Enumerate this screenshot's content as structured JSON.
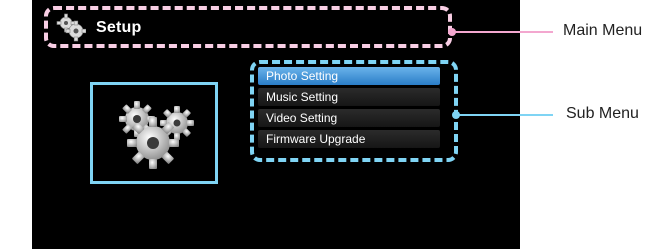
{
  "main_menu": {
    "title": "Setup",
    "icon": "gear-icon"
  },
  "sub_menu": {
    "items": [
      {
        "label": "Photo Setting",
        "active": true
      },
      {
        "label": "Music Setting",
        "active": false
      },
      {
        "label": "Video Setting",
        "active": false
      },
      {
        "label": "Firmware Upgrade",
        "active": false
      }
    ]
  },
  "callouts": {
    "main_menu_label": "Main Menu",
    "sub_menu_label": "Sub Menu"
  },
  "colors": {
    "main_menu_outline": "#f3a7cf",
    "sub_menu_outline": "#7fd4f4",
    "active_item": "#2a7dc8",
    "screen_bg": "#000000"
  }
}
